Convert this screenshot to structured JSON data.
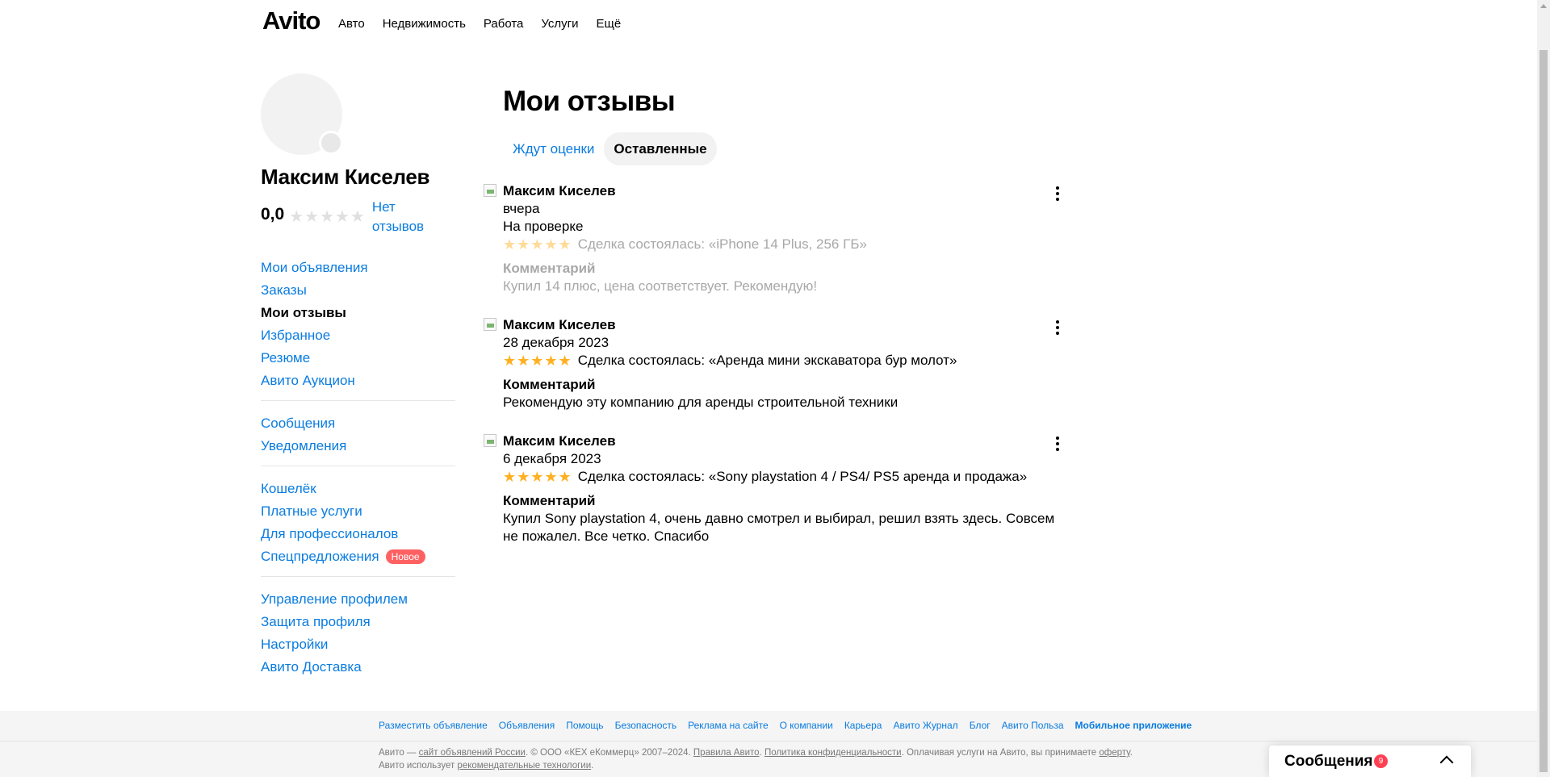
{
  "header": {
    "logo": "Avito",
    "nav": [
      "Авто",
      "Недвижимость",
      "Работа",
      "Услуги",
      "Ещё"
    ]
  },
  "profile": {
    "name": "Максим Киселев",
    "rating": "0,0",
    "reviews_link": "Нет отзывов"
  },
  "sidebar": {
    "groups": [
      [
        {
          "label": "Мои объявления"
        },
        {
          "label": "Заказы"
        },
        {
          "label": "Мои отзывы",
          "active": true
        },
        {
          "label": "Избранное"
        },
        {
          "label": "Резюме"
        },
        {
          "label": "Авито Аукцион"
        }
      ],
      [
        {
          "label": "Сообщения"
        },
        {
          "label": "Уведомления"
        }
      ],
      [
        {
          "label": "Кошелёк"
        },
        {
          "label": "Платные услуги"
        },
        {
          "label": "Для профессионалов"
        },
        {
          "label": "Спецпредложения",
          "badge": "Новое"
        }
      ],
      [
        {
          "label": "Управление профилем"
        },
        {
          "label": "Защита профиля"
        },
        {
          "label": "Настройки"
        },
        {
          "label": "Авито Доставка"
        }
      ]
    ]
  },
  "main": {
    "title": "Мои отзывы",
    "tabs": [
      {
        "label": "Ждут оценки",
        "active": false
      },
      {
        "label": "Оставленные",
        "active": true
      }
    ],
    "reviews": [
      {
        "author": "Максим Киселев",
        "date": "вчера",
        "status": "На проверке",
        "rating": 5,
        "deal": "Сделка состоялась: «iPhone 14 Plus, 256 ГБ»",
        "comment_label": "Комментарий",
        "comment": "Купил 14 плюс, цена соответствует. Рекомендую!",
        "pending": true
      },
      {
        "author": "Максим Киселев",
        "date": "28 декабря 2023",
        "status": "",
        "rating": 5,
        "deal": "Сделка состоялась: «Аренда мини экскаватора бур молот»",
        "comment_label": "Комментарий",
        "comment": "Рекомендую эту компанию для аренды строительной техники",
        "pending": false
      },
      {
        "author": "Максим Киселев",
        "date": "6 декабря 2023",
        "status": "",
        "rating": 5,
        "deal": "Сделка состоялась: «Sony playstation 4 / PS4/ PS5 аренда и продажа»",
        "comment_label": "Комментарий",
        "comment": "Купил Sony playstation 4, очень давно смотрел и выбирал, решил взять здесь. Совсем не пожалел. Все четко. Спасибо",
        "pending": false
      }
    ]
  },
  "footer": {
    "links": [
      "Разместить объявление",
      "Объявления",
      "Помощь",
      "Безопасность",
      "Реклама на сайте",
      "О компании",
      "Карьера",
      "Авито Журнал",
      "Блог",
      "Авито Польза"
    ],
    "links_strong": "Мобильное приложение",
    "legal": {
      "t1": "Авито — ",
      "l1": "сайт объявлений России",
      "t2": ". © ООО «КЕХ еКоммерц» 2007–2024. ",
      "l2": "Правила Авито",
      "t3": ". ",
      "l3": "Политика конфиденциальности",
      "t4": ". Оплачивая услуги на Авито, вы принимаете ",
      "l4": "оферту",
      "t5": ". Авито использует ",
      "l5": "рекомендательные технологии",
      "t6": "."
    }
  },
  "messenger": {
    "title": "Сообщения",
    "count": "9"
  },
  "colors": {
    "link": "#0a7ce0",
    "star": "#ffb021",
    "badge": "#ff6163"
  }
}
